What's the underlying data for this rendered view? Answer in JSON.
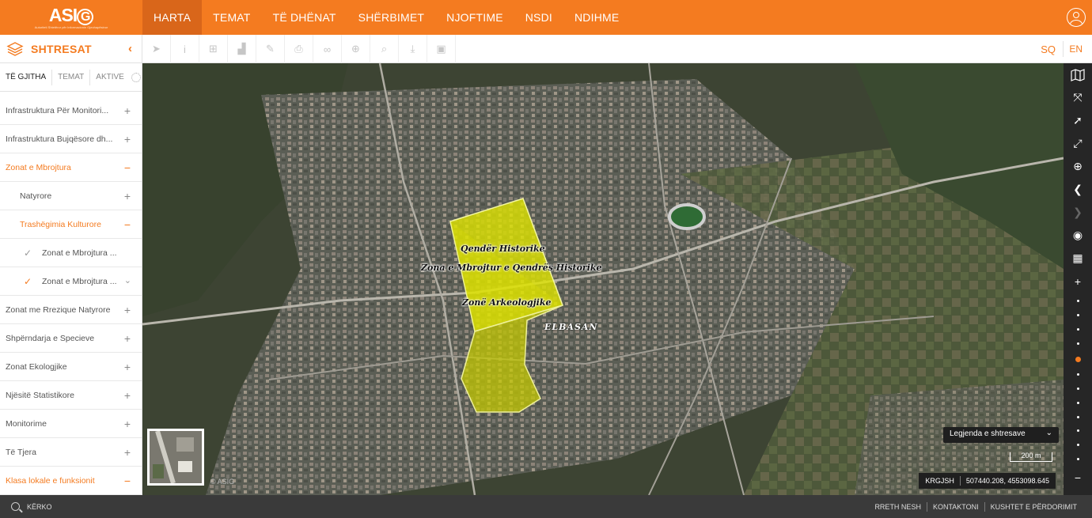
{
  "header": {
    "logo": "ASIG",
    "logo_sub": "Autoriteti Shtetëror për Informacionin Gjeohapësinor",
    "nav": [
      {
        "label": "HARTA",
        "active": true
      },
      {
        "label": "TEMAT"
      },
      {
        "label": "TË DHËNAT"
      },
      {
        "label": "SHËRBIMET"
      },
      {
        "label": "NJOFTIME"
      },
      {
        "label": "NSDI"
      },
      {
        "label": "NDIHME"
      }
    ],
    "user_icon": "user-icon"
  },
  "toolbar": {
    "layers_title": "SHTRESAT",
    "tools": [
      "pointer-icon",
      "info-icon",
      "add-layer-icon",
      "chart-icon",
      "edit-icon",
      "print-icon",
      "link-icon",
      "add-icon",
      "search-icon",
      "download-icon",
      "image-icon"
    ],
    "lang_sq": "SQ",
    "lang_en": "EN"
  },
  "sidebar": {
    "tabs": [
      {
        "label": "TË GJITHA",
        "active": true
      },
      {
        "label": "TEMAT"
      },
      {
        "label": "AKTIVE"
      }
    ],
    "items": [
      {
        "label": "Infrastruktura Për Monitori...",
        "level": 1,
        "action": "+"
      },
      {
        "label": "Infrastruktura Bujqësore dh...",
        "level": 1,
        "action": "+"
      },
      {
        "label": "Zonat e Mbrojtura",
        "level": 1,
        "action": "−",
        "open": true
      },
      {
        "label": "Natyrore",
        "level": 2,
        "action": "+"
      },
      {
        "label": "Trashëgimia Kulturore",
        "level": 2,
        "action": "−",
        "open": true
      },
      {
        "label": "Zonat e Mbrojtura ...",
        "level": 3,
        "check": "✓",
        "checked": false
      },
      {
        "label": "Zonat e Mbrojtura ...",
        "level": 3,
        "check": "✓",
        "checked": true,
        "chevron": "⌄"
      },
      {
        "label": "Zonat me Rrezique Natyrore",
        "level": 1,
        "action": "+"
      },
      {
        "label": "Shpërndarja e Specieve",
        "level": 1,
        "action": "+"
      },
      {
        "label": "Zonat Ekologjike",
        "level": 1,
        "action": "+"
      },
      {
        "label": "Njësitë Statistikore",
        "level": 1,
        "action": "+"
      },
      {
        "label": "Monitorime",
        "level": 1,
        "action": "+"
      },
      {
        "label": "Të Tjera",
        "level": 1,
        "action": "+"
      },
      {
        "label": "Klasa lokale e funksionit",
        "level": 1,
        "action": "−",
        "open": true
      }
    ]
  },
  "map": {
    "labels": {
      "qender": "Qendër Historike",
      "zona": "Zona e Mbrojtur e Qendrës Historike",
      "arkeo": "Zonë Arkeologjike",
      "city": "ELBASAN"
    },
    "copyright": "© ASIG",
    "legend": "Legjenda e shtresave",
    "scale": "200 m",
    "crs": "KRGJSH",
    "coords": "507440.208, 4553098.645"
  },
  "rightbar": {
    "icons": [
      "basemap-icon",
      "fullscreen-icon",
      "locate-icon",
      "expand-icon",
      "zoom-in-icon",
      "back-icon",
      "forward-icon",
      "globe-icon",
      "grid-icon"
    ],
    "zoom_in": "+",
    "zoom_out": "−",
    "zoom_levels": 12,
    "zoom_current": 4
  },
  "footer": {
    "search": "KËRKO",
    "links": [
      "RRETH NESH",
      "KONTAKTONI",
      "KUSHTET E PËRDORIMIT"
    ]
  },
  "colors": {
    "accent": "#f47b20",
    "dark": "#262626",
    "zone_fill": "#dfe400"
  }
}
